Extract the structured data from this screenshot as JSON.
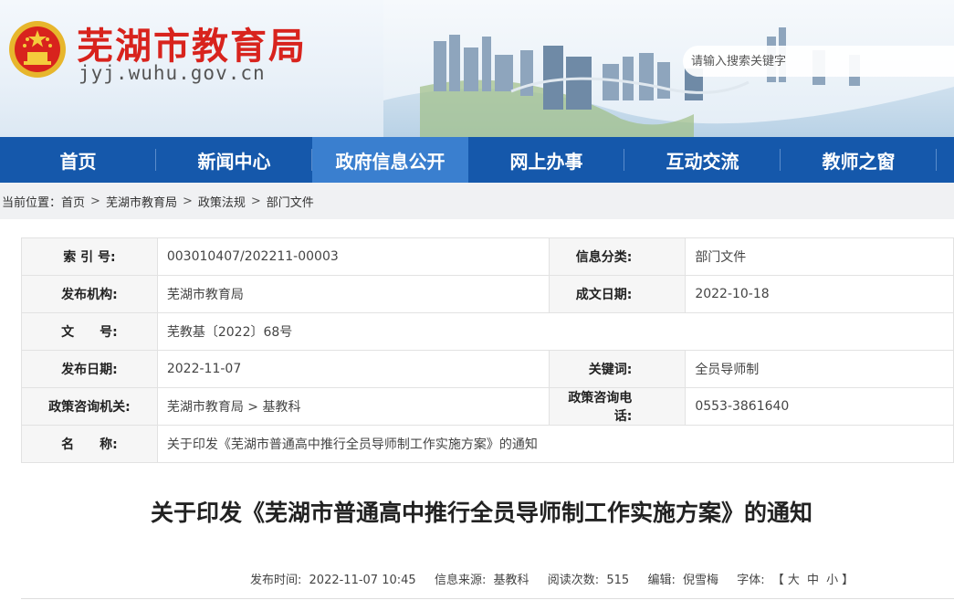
{
  "header": {
    "site_title": "芜湖市教育局",
    "site_url": "jyj.wuhu.gov.cn",
    "search_placeholder": "请输入搜索关键字"
  },
  "nav": {
    "items": [
      {
        "label": "首页"
      },
      {
        "label": "新闻中心"
      },
      {
        "label": "政府信息公开"
      },
      {
        "label": "网上办事"
      },
      {
        "label": "互动交流"
      },
      {
        "label": "教师之窗"
      }
    ],
    "active_index": 2
  },
  "breadcrumb": {
    "prefix": "当前位置：",
    "items": [
      "首页",
      "芜湖市教育局",
      "政策法规",
      "部门文件"
    ],
    "separator": ">"
  },
  "info": {
    "index_no_label": "索 引 号:",
    "index_no": "003010407/202211-00003",
    "category_label": "信息分类:",
    "category": "部门文件",
    "publisher_label": "发布机构:",
    "publisher": "芜湖市教育局",
    "written_date_label": "成文日期:",
    "written_date": "2022-10-18",
    "doc_no_label": "文　　号:",
    "doc_no": "芜教基〔2022〕68号",
    "publish_date_label": "发布日期:",
    "publish_date": "2022-11-07",
    "keywords_label": "关键词:",
    "keywords": "全员导师制",
    "consult_org_label": "政策咨询机关:",
    "consult_org": "芜湖市教育局 > 基教科",
    "consult_phone_label": "政策咨询电话:",
    "consult_phone": "0553-3861640",
    "name_label": "名　　称:",
    "name": "关于印发《芜湖市普通高中推行全员导师制工作实施方案》的通知"
  },
  "article": {
    "title": "关于印发《芜湖市普通高中推行全员导师制工作实施方案》的通知",
    "publish_time_label": "发布时间:",
    "publish_time": "2022-11-07 10:45",
    "source_label": "信息来源:",
    "source": "基教科",
    "views_label": "阅读次数:",
    "views": "515",
    "editor_label": "编辑:",
    "editor": "倪雪梅",
    "font_label": "字体:",
    "font_open": "【",
    "font_large": "大",
    "font_medium": "中",
    "font_small": "小",
    "font_close": "】"
  },
  "colors": {
    "brand_red": "#d8231d",
    "nav_blue": "#1558ab",
    "nav_active": "#3a7fcf"
  }
}
